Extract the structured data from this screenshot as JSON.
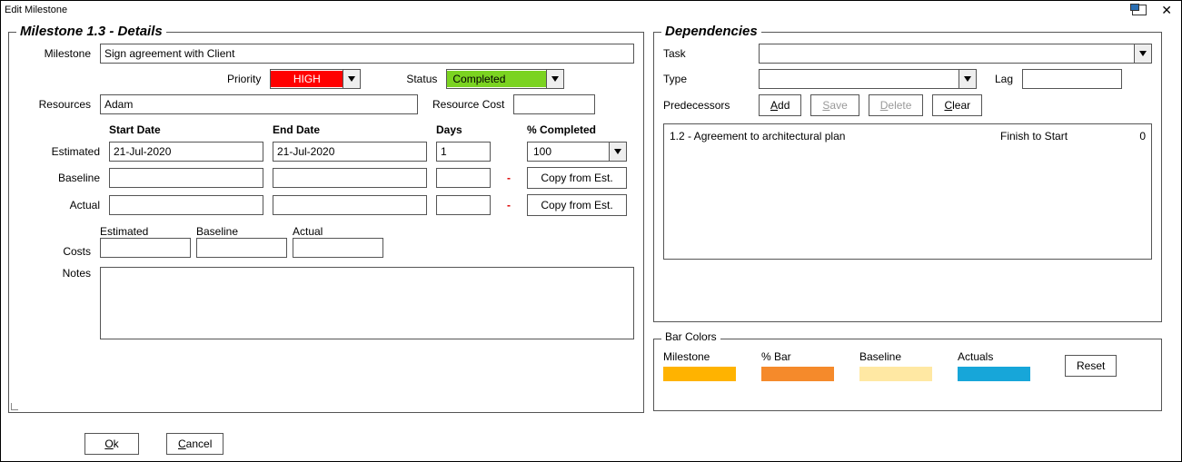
{
  "window": {
    "title": "Edit Milestone"
  },
  "details": {
    "heading": "Milestone 1.3 - Details",
    "labels": {
      "milestone": "Milestone",
      "priority": "Priority",
      "status": "Status",
      "resources": "Resources",
      "resource_cost": "Resource Cost",
      "start_date": "Start Date",
      "end_date": "End Date",
      "days": "Days",
      "pct_completed": "% Completed",
      "estimated": "Estimated",
      "baseline": "Baseline",
      "actual": "Actual",
      "costs": "Costs",
      "costs_est": "Estimated",
      "costs_base": "Baseline",
      "costs_act": "Actual",
      "notes": "Notes"
    },
    "values": {
      "milestone": "Sign agreement with Client",
      "priority": "HIGH",
      "status": "Completed",
      "resources": "Adam",
      "resource_cost": "",
      "est_start": "21-Jul-2020",
      "est_end": "21-Jul-2020",
      "est_days": "1",
      "est_pct": "100",
      "base_start": "",
      "base_end": "",
      "base_days": "",
      "act_start": "",
      "act_end": "",
      "act_days": "",
      "cost_est": "",
      "cost_base": "",
      "cost_act": "",
      "notes": ""
    },
    "buttons": {
      "copy_from_est": "Copy from Est.",
      "ok": "Ok",
      "cancel": "Cancel"
    }
  },
  "deps": {
    "heading": "Dependencies",
    "labels": {
      "task": "Task",
      "type": "Type",
      "lag": "Lag",
      "predecessors": "Predecessors"
    },
    "values": {
      "task": "",
      "type": "",
      "lag": ""
    },
    "buttons": {
      "add": "Add",
      "save": "Save",
      "delete": "Delete",
      "clear": "Clear"
    },
    "list": [
      {
        "name": "1.2 - Agreement to architectural plan",
        "type": "Finish to Start",
        "lag": "0"
      }
    ]
  },
  "bars": {
    "heading": "Bar Colors",
    "reset": "Reset",
    "items": [
      {
        "label": "Milestone",
        "color": "#ffb300"
      },
      {
        "label": "% Bar",
        "color": "#f58a2b"
      },
      {
        "label": "Baseline",
        "color": "#ffe8a3"
      },
      {
        "label": "Actuals",
        "color": "#17a6d9"
      }
    ]
  }
}
